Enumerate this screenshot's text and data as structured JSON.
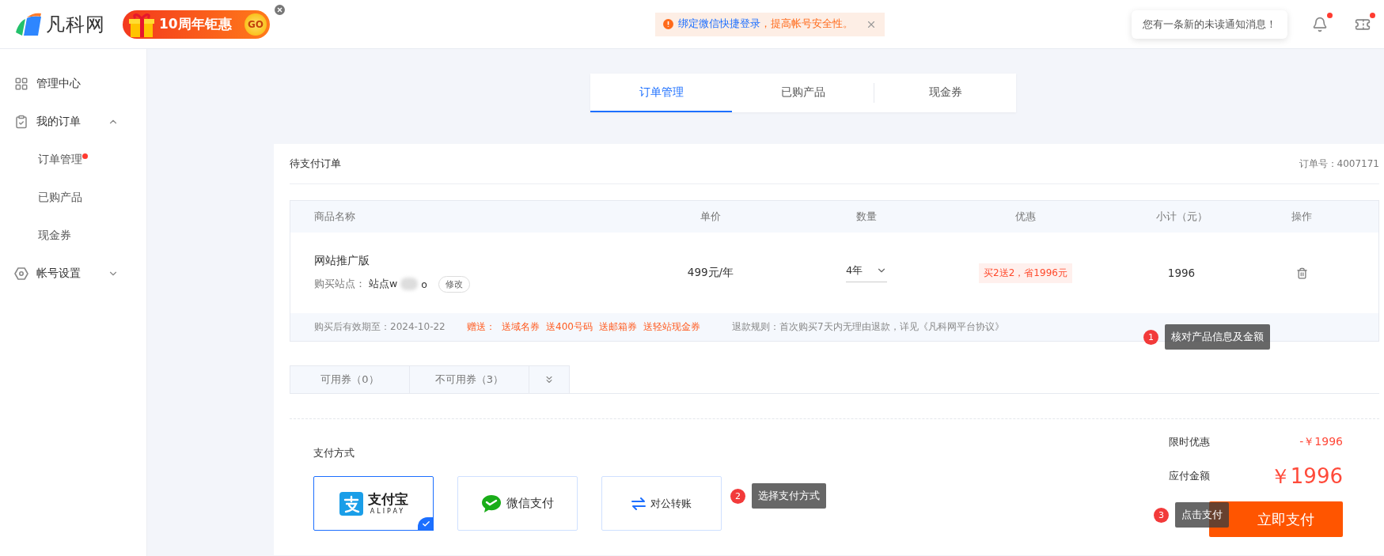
{
  "header": {
    "logo_text": "凡科网",
    "promo": {
      "text": "10周年钜惠",
      "go": "GO"
    },
    "notice": {
      "link": "绑定微信快捷登录",
      "text": "，提高帐号安全性。"
    },
    "notification_tip": "您有一条新的未读通知消息！",
    "icons": [
      {
        "kind": "bell",
        "badge": true
      },
      {
        "kind": "ticket",
        "badge": true
      }
    ]
  },
  "sidebar": {
    "items": [
      {
        "kind": "grid",
        "label": "管理中心"
      },
      {
        "kind": "orders",
        "label": "我的订单",
        "expanded": true,
        "children": [
          {
            "label": "订单管理",
            "badge": true
          },
          {
            "label": "已购产品",
            "badge": false
          },
          {
            "label": "现金券",
            "badge": false
          }
        ]
      },
      {
        "kind": "settings",
        "label": "帐号设置",
        "expanded": false
      }
    ]
  },
  "tabs": [
    {
      "label": "订单管理",
      "selected": true
    },
    {
      "label": "已购产品",
      "selected": false
    },
    {
      "label": "现金券",
      "selected": false
    }
  ],
  "order": {
    "title": "待支付订单",
    "order_no": "订单号：4007171",
    "columns": [
      "商品名称",
      "单价",
      "数量",
      "优惠",
      "小计（元）",
      "操作"
    ],
    "rows": [
      {
        "product": "网站推广版",
        "site_label": "购买站点：",
        "site_prefix": "站点w",
        "site_suffix": "o",
        "edit": "修改",
        "price": "499元/年",
        "quantity": "4年",
        "discount": "买2送2，省1996元",
        "subtotal": "1996"
      }
    ],
    "validity": "购买后有效期至：2024-10-22",
    "gifts_label": "赠送：",
    "gifts": [
      "送域名券",
      "送400号码",
      "送邮箱券",
      "送轻站现金券"
    ],
    "refund": "退款规则：首次购买7天内无理由退款，详见《凡科网平台协议》"
  },
  "coupon_tabs": [
    "可用券（0）",
    "不可用券（3）"
  ],
  "payment": {
    "title": "支付方式",
    "methods": [
      {
        "kind": "alipay",
        "label": "支付宝",
        "sublabel": "ALIPAY",
        "selected": true
      },
      {
        "kind": "wechat",
        "label": "微信支付",
        "selected": false
      },
      {
        "kind": "transfer",
        "label": "对公转账",
        "selected": false
      }
    ]
  },
  "summary": {
    "discount_label": "限时优惠",
    "discount": "-￥1996",
    "total_label": "应付金额",
    "total": "￥1996",
    "pay_button": "立即支付"
  },
  "guides": [
    {
      "number": "1",
      "text": "核对产品信息及金额"
    },
    {
      "number": "2",
      "text": "选择支付方式"
    },
    {
      "number": "3",
      "text": "点击支付"
    }
  ]
}
